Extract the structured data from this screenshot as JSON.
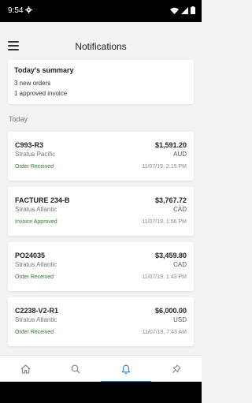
{
  "status_bar": {
    "time": "9:54"
  },
  "app_bar": {
    "title": "Notifications"
  },
  "summary": {
    "heading": "Today's summary",
    "lines": [
      "3 new orders",
      "1 approved invoice"
    ]
  },
  "section_label": "Today",
  "notifications": [
    {
      "number": "C993-R3",
      "company": "Stratus Pacific",
      "status": "Order Received",
      "amount": "$1,591.20",
      "currency": "AUD",
      "date": "11/07/19, 2:15 PM"
    },
    {
      "number": "FACTURE 234-B",
      "company": "Stratus Atlantic",
      "status": "Invoice Approved",
      "amount": "$3,767.72",
      "currency": "CAD",
      "date": "11/07/19, 1:56 PM"
    },
    {
      "number": "PO24035",
      "company": "Stratus Atlantic",
      "status": "Order Received",
      "amount": "$3,459.80",
      "currency": "CAD",
      "date": "11/07/19, 1:43 PM"
    },
    {
      "number": "C2238-V2-R1",
      "company": "Stratus Atlantic",
      "status": "Order Received",
      "amount": "$6,000.00",
      "currency": "USD",
      "date": "11/07/19, 7:43 AM"
    }
  ],
  "tabs": [
    {
      "icon": "home-icon",
      "active": false
    },
    {
      "icon": "search-icon",
      "active": false
    },
    {
      "icon": "bell-icon",
      "active": true
    },
    {
      "icon": "pin-icon",
      "active": false
    }
  ],
  "colors": {
    "accent": "#1e88e5",
    "status_green": "#2e7d32"
  }
}
